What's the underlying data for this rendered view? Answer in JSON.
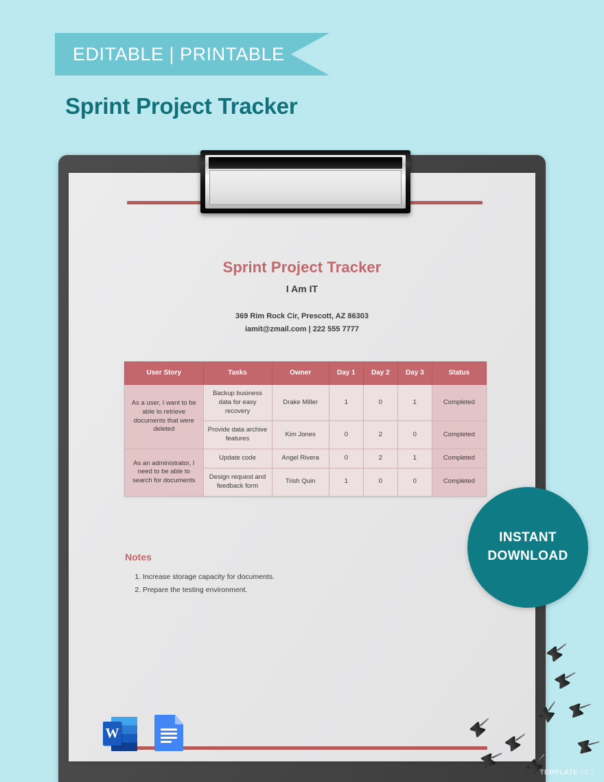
{
  "banner": {
    "label": "EDITABLE | PRINTABLE",
    "color": "#6ec6d2"
  },
  "page_title": "Sprint Project Tracker",
  "theme": {
    "background": "#bce9f0",
    "teal": "#11717b",
    "accent_red": "#b85959",
    "table_header": "#c4676c",
    "badge_teal": "#0f7b84"
  },
  "document": {
    "title": "Sprint Project Tracker",
    "company": "I Am IT",
    "address": "369 Rim Rock Cir, Prescott, AZ 86303",
    "contact": "iamit@zmail.com | 222 555 7777",
    "table": {
      "columns": [
        "User Story",
        "Tasks",
        "Owner",
        "Day 1",
        "Day 2",
        "Day 3",
        "Status"
      ],
      "groups": [
        {
          "user_story": "As a user, I want to be able to retrieve documents that were deleted",
          "rows": [
            {
              "task": "Backup business data for easy recovery",
              "owner": "Drake Miller",
              "day1": "1",
              "day2": "0",
              "day3": "1",
              "status": "Completed"
            },
            {
              "task": "Provide data archive features",
              "owner": "Kim Jones",
              "day1": "0",
              "day2": "2",
              "day3": "0",
              "status": "Completed"
            }
          ]
        },
        {
          "user_story": "As an administrator, I need to be able to search for documents",
          "rows": [
            {
              "task": "Update code",
              "owner": "Angel Rivera",
              "day1": "0",
              "day2": "2",
              "day3": "1",
              "status": "Completed"
            },
            {
              "task": "Design request and feedback form",
              "owner": "Trish Quin",
              "day1": "1",
              "day2": "0",
              "day3": "0",
              "status": "Completed"
            }
          ]
        }
      ]
    },
    "notes": {
      "heading": "Notes",
      "items": [
        "Increase storage capacity for documents.",
        "Prepare the testing environment."
      ]
    }
  },
  "file_formats": [
    {
      "name": "microsoft-word",
      "letter": "W"
    },
    {
      "name": "google-docs",
      "letter": ""
    }
  ],
  "instant_download": {
    "line1": "INSTANT",
    "line2": "DOWNLOAD"
  },
  "watermark": {
    "prefix": "TEMPLATE",
    "suffix": ".NET"
  }
}
